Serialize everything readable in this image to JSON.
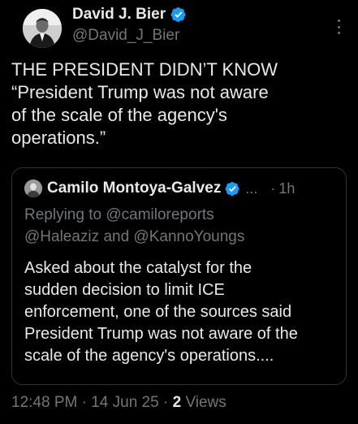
{
  "author": {
    "name": "David J. Bier",
    "handle": "@David_J_Bier"
  },
  "tweet": {
    "lines": [
      "THE PRESIDENT DIDN’T KNOW",
      "“President Trump was not aware",
      "of the scale of the agency's",
      "operations.”"
    ]
  },
  "quoted": {
    "name": "Camilo Montoya-Galvez",
    "ellipsis": "...",
    "dot": "·",
    "time": "1h",
    "replying_prefix": "Replying to",
    "mention_1": "@camiloreports",
    "mention_2": "@Haleaziz",
    "and_word": "and",
    "mention_3": "@KannoYoungs",
    "lines": [
      "Asked about the catalyst for the",
      "sudden decision to limit ICE",
      "enforcement, one of the sources said",
      "President Trump was not aware of the",
      "scale of the agency's operations...."
    ]
  },
  "meta": {
    "time": "12:48 PM",
    "sep": "·",
    "date": "14 Jun 25",
    "views_count": "2",
    "views_label": "Views"
  },
  "colors": {
    "background": "#000000",
    "text": "#e7e9ea",
    "secondary": "#71767b",
    "verified": "#1d9bf0",
    "border": "#2f3336"
  }
}
